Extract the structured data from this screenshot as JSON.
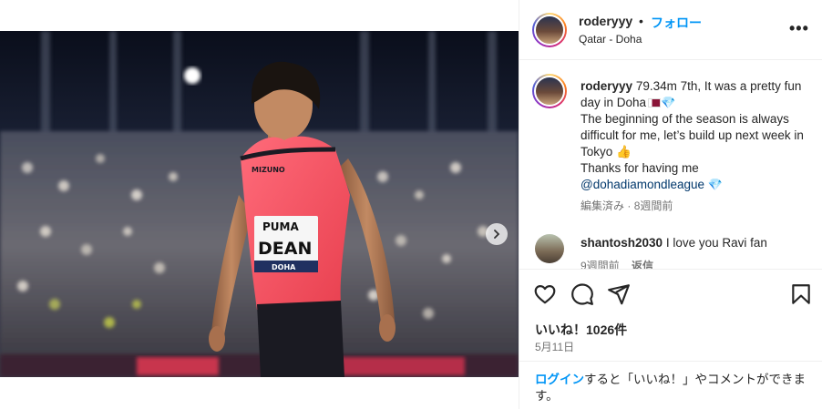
{
  "post": {
    "username": "roderyyy",
    "separator": "•",
    "follow_label": "フォロー",
    "location": "Qatar - Doha",
    "more_icon": "more-horizontal-icon"
  },
  "caption": {
    "username": "roderyyy",
    "line1": "79.34m 7th, It was a pretty fun day in Doha",
    "line2": "The beginning of the season is always difficult for me, let’s build up next week in Tokyo",
    "line3": "Thanks for having me",
    "mention": "@dohadiamondleague",
    "edited_label": "編集済み",
    "meta_separator": "·",
    "age": "8週間前"
  },
  "comment": {
    "username": "shantosh2030",
    "text": "I love you Ravi fan",
    "age": "9週間前",
    "reply_label": "返信"
  },
  "photo": {
    "brand_top": "MIZUNO",
    "bib_brand": "PUMA",
    "bib_name": "DEAN",
    "bib_city": "DOHA"
  },
  "carousel": {
    "slide_count": 2,
    "active_index": 0
  },
  "engagement": {
    "likes_label": "いいね！1026件",
    "date": "5月11日"
  },
  "login_prompt": {
    "link_text": "ログイン",
    "rest_text": "すると「いいね！」やコメントができます。"
  },
  "colors": {
    "accent": "#0095f6",
    "text": "#262626",
    "muted": "#737373",
    "divider": "#efefef",
    "jersey": "#f0556a",
    "active_dot": "#3f8cff"
  }
}
